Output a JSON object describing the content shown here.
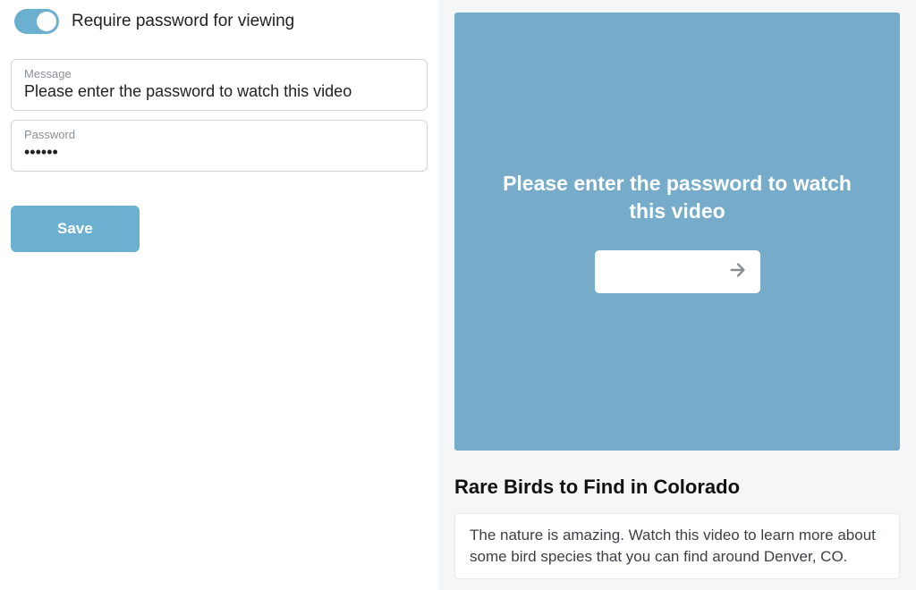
{
  "settings": {
    "toggle_label": "Require password for viewing",
    "message_field": {
      "label": "Message",
      "value": "Please enter the password to watch this video"
    },
    "password_field": {
      "label": "Password",
      "value": "••••••"
    },
    "save_label": "Save"
  },
  "preview": {
    "message": "Please enter the password to watch this video",
    "video_title": "Rare Birds to Find in Colorado",
    "video_description": "The nature is amazing. Watch this video to learn more about some bird species that you can find around Denver, CO."
  }
}
